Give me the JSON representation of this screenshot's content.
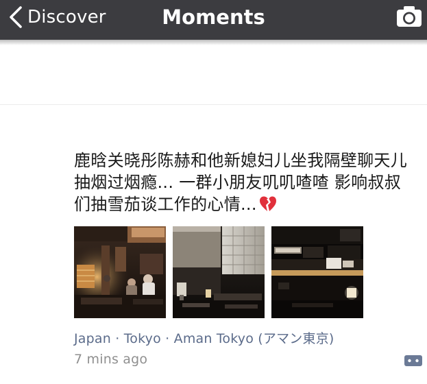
{
  "navbar": {
    "back_label": "Discover",
    "title": "Moments",
    "camera_icon": "camera-icon",
    "back_icon": "chevron-left-icon",
    "background_color": "#3c3c40"
  },
  "post": {
    "text": "鹿晗关晓彤陈赫和他新媳妇儿坐我隔壁聊天儿抽烟过烟瘾... 一群小朋友叽叽喳喳 影响叔叔们抽雪茄谈工作的心情...",
    "emoji_icon": "broken-heart-icon",
    "photos": [
      {
        "icon": "photo-restaurant-interior"
      },
      {
        "icon": "photo-lobby-window"
      },
      {
        "icon": "photo-dark-bar"
      }
    ],
    "location": "Japan · Tokyo · Aman Tokyo (アマン東京)",
    "time": "7 mins ago",
    "comment_icon": "comment-icon",
    "link_color": "#5b6b8a"
  }
}
